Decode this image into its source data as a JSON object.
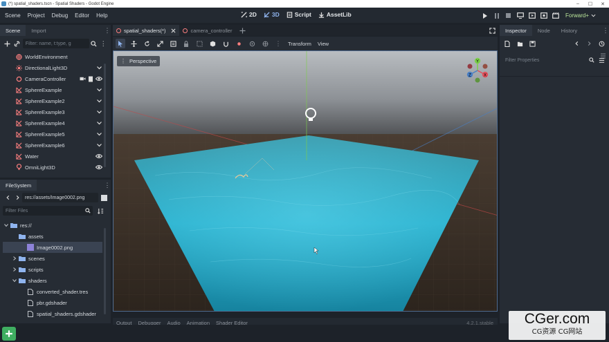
{
  "window": {
    "title": "(*) spatial_shaders.tscn - Spatial Shaders - Godot Engine",
    "minimize": "–",
    "maximize": "☐",
    "close": "✕"
  },
  "menu": [
    "Scene",
    "Project",
    "Debug",
    "Editor",
    "Help"
  ],
  "workspaces": [
    {
      "label": "2D",
      "icon": "2d-workspace-icon"
    },
    {
      "label": "3D",
      "icon": "3d-workspace-icon"
    },
    {
      "label": "Script",
      "icon": "script-workspace-icon"
    },
    {
      "label": "AssetLib",
      "icon": "assetlib-workspace-icon"
    }
  ],
  "renderer": "Forward+",
  "scene_dock": {
    "tabs": [
      "Scene",
      "Import"
    ],
    "filter_placeholder": "Filter: name, t:type, g",
    "nodes": [
      {
        "name": "WorldEnvironment",
        "icon": "world-environment-icon",
        "color": "#fc7f7f",
        "vis": ""
      },
      {
        "name": "DirectionalLight3D",
        "icon": "directional-light-icon",
        "color": "#fc7f7f",
        "vis": "chevron"
      },
      {
        "name": "CameraController",
        "icon": "node3d-icon",
        "color": "#fc7f7f",
        "vis": "eye",
        "extra": true
      },
      {
        "name": "SphereExample",
        "icon": "mesh-instance-icon",
        "color": "#fc7f7f",
        "vis": "chevron"
      },
      {
        "name": "SphereExample2",
        "icon": "mesh-instance-icon",
        "color": "#fc7f7f",
        "vis": "chevron"
      },
      {
        "name": "SphereExample3",
        "icon": "mesh-instance-icon",
        "color": "#fc7f7f",
        "vis": "chevron"
      },
      {
        "name": "SphereExample4",
        "icon": "mesh-instance-icon",
        "color": "#fc7f7f",
        "vis": "chevron"
      },
      {
        "name": "SphereExample5",
        "icon": "mesh-instance-icon",
        "color": "#fc7f7f",
        "vis": "chevron"
      },
      {
        "name": "SphereExample6",
        "icon": "mesh-instance-icon",
        "color": "#fc7f7f",
        "vis": "chevron"
      },
      {
        "name": "Water",
        "icon": "mesh-instance-icon",
        "color": "#fc7f7f",
        "vis": "eye"
      },
      {
        "name": "OmniLight3D",
        "icon": "omni-light-icon",
        "color": "#fc7f7f",
        "vis": "eye"
      }
    ]
  },
  "filesystem": {
    "tab": "FileSystem",
    "path": "res://assets/Image0002.png",
    "filter_placeholder": "Filter Files",
    "items": [
      {
        "label": "res://",
        "type": "folder",
        "depth": 0,
        "arrow": "down"
      },
      {
        "label": "assets",
        "type": "folder",
        "depth": 1,
        "arrow": ""
      },
      {
        "label": "Image0002.png",
        "type": "image",
        "depth": 2,
        "arrow": "",
        "selected": true
      },
      {
        "label": "scenes",
        "type": "folder",
        "depth": 1,
        "arrow": "right"
      },
      {
        "label": "scripts",
        "type": "folder",
        "depth": 1,
        "arrow": "right"
      },
      {
        "label": "shaders",
        "type": "folder",
        "depth": 1,
        "arrow": "down"
      },
      {
        "label": "converted_shader.tres",
        "type": "file",
        "depth": 2,
        "arrow": ""
      },
      {
        "label": "pbr.gdshader",
        "type": "file",
        "depth": 2,
        "arrow": ""
      },
      {
        "label": "spatial_shaders.gdshader",
        "type": "file",
        "depth": 2,
        "arrow": ""
      }
    ]
  },
  "editor_tabs": [
    "spatial_shaders(*)",
    "camera_controller"
  ],
  "toolbar": {
    "transform": "Transform",
    "view": "View"
  },
  "viewport": {
    "perspective": "Perspective",
    "gizmo": {
      "y": "Y",
      "x": "X",
      "z": "Z"
    }
  },
  "inspector": {
    "tabs": [
      "Inspector",
      "Node",
      "History"
    ],
    "filter_placeholder": "Filter Properties"
  },
  "bottom_panel": {
    "tabs": [
      "Output",
      "Debugger",
      "Audio",
      "Animation",
      "Shader Editor"
    ],
    "version": "4.2.1.stable"
  },
  "watermark": {
    "main": "CGer.com",
    "sub": "CG资源 CG网站"
  }
}
